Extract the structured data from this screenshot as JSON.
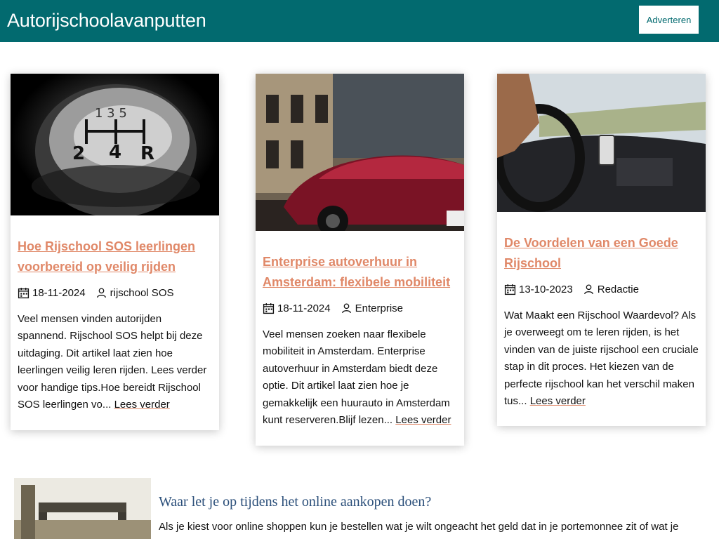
{
  "header": {
    "site_title": "Autorijschoolavanputten",
    "advertise_label": "Adverteren",
    "background_color": "#026a6f"
  },
  "cards": [
    {
      "title": "Hoe Rijschool SOS leerlingen voorbereid op veilig rijden",
      "date": "18-11-2024",
      "author": "rijschool SOS",
      "excerpt": "Veel mensen vinden autorijden spannend. Rijschool SOS helpt bij deze uitdaging. Dit artikel laat zien hoe leerlingen veilig leren rijden. Lees verder voor handige tips.Hoe bereidt Rijschool SOS leerlingen vo...",
      "read_more": "Lees verder",
      "image_alt": "gear shift knob"
    },
    {
      "title": "Enterprise autoverhuur in Amsterdam: flexibele mobiliteit",
      "date": "18-11-2024",
      "author": "Enterprise",
      "excerpt": "Veel mensen zoeken naar flexibele mobiliteit in Amsterdam. Enterprise autoverhuur in Amsterdam biedt deze optie. Dit artikel laat zien hoe je gemakkelijk een huurauto in Amsterdam kunt reserveren.Blijf lezen...",
      "read_more": "Lees verder",
      "image_alt": "red sports car"
    },
    {
      "title": "De Voordelen van een Goede Rijschool",
      "date": "13-10-2023",
      "author": "Redactie",
      "excerpt": "Wat Maakt een Rijschool Waardevol? Als je overweegt om te leren rijden, is het vinden van de juiste rijschool een cruciale stap in dit proces. Het kiezen van de perfecte rijschool kan het verschil maken tus...",
      "read_more": "Lees verder",
      "image_alt": "driver steering wheel"
    }
  ],
  "bottom_article": {
    "title": "Waar let je op tijdens het online aankopen doen?",
    "excerpt": "Als je kiest voor online shoppen kun je bestellen wat je wilt ongeacht het geld dat in je portemonnee zit of wat je"
  },
  "colors": {
    "link": "#e08868",
    "bottom_title": "#2b4f7a"
  },
  "icons": {
    "date": "calendar-icon",
    "author": "user-icon"
  }
}
